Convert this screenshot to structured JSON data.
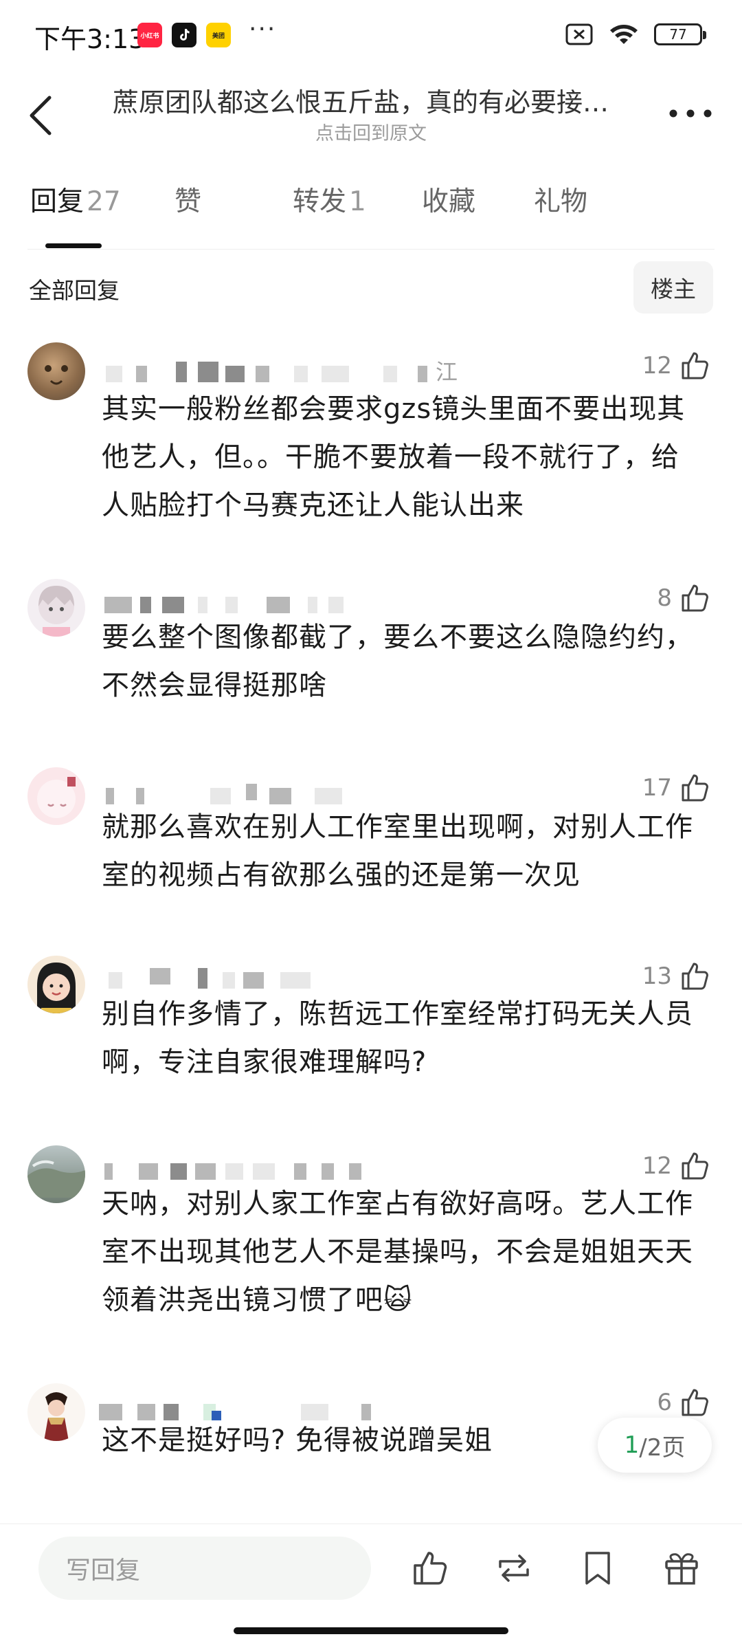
{
  "status_bar": {
    "time": "下午3:13",
    "apps": [
      {
        "name": "小红书",
        "color": "#ff2442"
      },
      {
        "name": "抖音",
        "color": "#111111"
      },
      {
        "name": "美团",
        "color": "#ffd100"
      }
    ],
    "dots": "···",
    "battery": "77"
  },
  "header": {
    "title": "蔗原团队都这么恨五斤盐，真的有必要接…",
    "subtitle": "点击回到原文"
  },
  "tabs": [
    {
      "label": "回复",
      "count": "27"
    },
    {
      "label": "赞",
      "count": ""
    },
    {
      "label": "转发",
      "count": "1"
    },
    {
      "label": "收藏",
      "count": ""
    },
    {
      "label": "礼物",
      "count": ""
    }
  ],
  "section": {
    "label": "全部回复",
    "op_button": "楼主"
  },
  "comments": [
    {
      "location": "江",
      "likes": "12",
      "text": "其实一般粉丝都会要求gzs镜头里面不要出现其他艺人，但。。干脆不要放着一段不就行了，给人贴脸打个马赛克还让人能认出来"
    },
    {
      "location": "",
      "likes": "8",
      "text": "要么整个图像都截了，要么不要这么隐隐约约，不然会显得挺那啥"
    },
    {
      "location": "",
      "likes": "17",
      "text": "就那么喜欢在别人工作室里出现啊，对别人工作室的视频占有欲那么强的还是第一次见"
    },
    {
      "location": "",
      "likes": "13",
      "text": "别自作多情了，陈哲远工作室经常打码无关人员啊，专注自家很难理解吗?"
    },
    {
      "location": "",
      "likes": "12",
      "text": "天呐，对别人家工作室占有欲好高呀。艺人工作室不出现其他艺人不是基操吗，不会是姐姐天天领着洪尧出镜习惯了吧🙀"
    },
    {
      "location": "",
      "likes": "6",
      "text": "这不是挺好吗? 免得被说蹭吴姐"
    }
  ],
  "pager": {
    "current": "1",
    "total": "/2页"
  },
  "bottom_bar": {
    "reply_placeholder": "写回复"
  },
  "colors": {
    "accent_green": "#1f9d55",
    "tab_underline": "#111111"
  }
}
